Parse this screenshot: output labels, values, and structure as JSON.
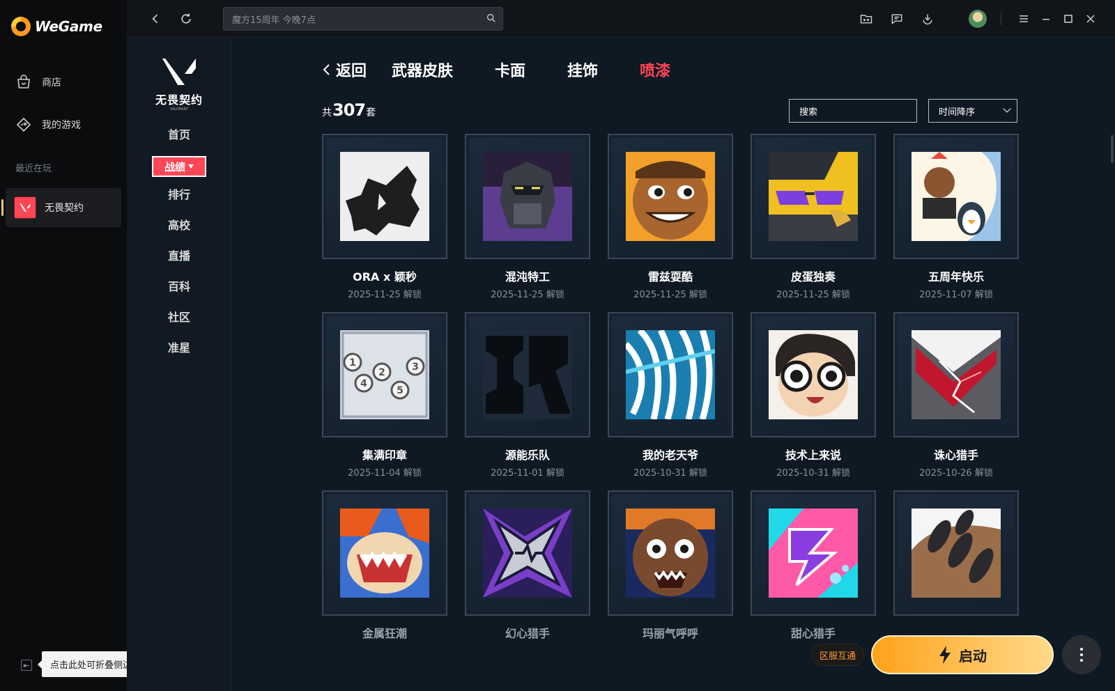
{
  "app": {
    "name": "WeGame"
  },
  "sidebar": {
    "store_label": "商店",
    "mygames_label": "我的游戏",
    "recent_label": "最近在玩",
    "recent_game": "无畏契约",
    "collapse_tooltip": "点击此处可折叠侧边栏"
  },
  "topbar": {
    "search_placeholder": "魔方15周年 今晚7点"
  },
  "game": {
    "name": "无畏契约",
    "name_en": "VALORANT",
    "nav": [
      "首页",
      "战绩",
      "排行",
      "高校",
      "直播",
      "百科",
      "社区",
      "准星"
    ],
    "active_nav": "战绩"
  },
  "main": {
    "back_label": "返回",
    "tabs": [
      "武器皮肤",
      "卡面",
      "挂饰",
      "喷漆"
    ],
    "active_tab": "喷漆",
    "count_prefix": "共",
    "count_value": "307",
    "count_suffix": "套",
    "search_label": "搜索",
    "sort_label": "时间降序",
    "unlock_suffix": "解锁"
  },
  "cards": [
    {
      "name": "ORA x 颖秒",
      "date": "2025-11-25 解锁"
    },
    {
      "name": "混沌特工",
      "date": "2025-11-25 解锁"
    },
    {
      "name": "雷兹耍酷",
      "date": "2025-11-25 解锁"
    },
    {
      "name": "皮蛋独奏",
      "date": "2025-11-25 解锁"
    },
    {
      "name": "五周年快乐",
      "date": "2025-11-07 解锁"
    },
    {
      "name": "集满印章",
      "date": "2025-11-04 解锁"
    },
    {
      "name": "源能乐队",
      "date": "2025-11-01 解锁"
    },
    {
      "name": "我的老天爷",
      "date": "2025-10-31 解锁"
    },
    {
      "name": "技术上来说",
      "date": "2025-10-31 解锁"
    },
    {
      "name": "诛心猎手",
      "date": "2025-10-26 解锁"
    },
    {
      "name": "金属狂潮",
      "date": ""
    },
    {
      "name": "幻心猎手",
      "date": ""
    },
    {
      "name": "玛丽气呼呼",
      "date": ""
    },
    {
      "name": "甜心猎手",
      "date": ""
    },
    {
      "name": "",
      "date": ""
    }
  ],
  "bottom": {
    "region_label": "区服互通",
    "launch_label": "启动"
  },
  "colors": {
    "accent": "#ff4655",
    "launch": "#ffa21a",
    "bg": "#0f1923"
  }
}
